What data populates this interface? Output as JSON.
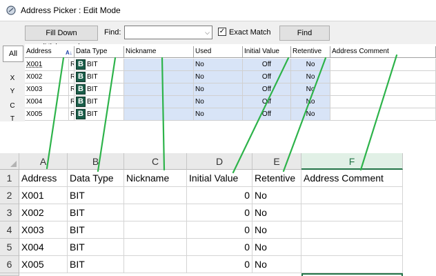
{
  "window": {
    "title": "Address Picker : Edit Mode"
  },
  "toolbar": {
    "fill_down_label": "Fill Down (Nickname)",
    "find_label": "Find:",
    "find_value": "",
    "exact_match_label": "Exact Match",
    "exact_match_checked": true,
    "find_button_label": "Find"
  },
  "side_tabs": [
    "All",
    "X",
    "Y",
    "C",
    "T"
  ],
  "picker_grid": {
    "columns": [
      "Address",
      "Data Type",
      "Nickname",
      "Used",
      "Initial Value",
      "Retentive",
      "Address Comment"
    ],
    "rows": [
      {
        "address": "X001",
        "flag": "R",
        "type": "BIT",
        "nickname": "",
        "used": "No",
        "initial": "Off",
        "retentive": "No",
        "comment": ""
      },
      {
        "address": "X002",
        "flag": "R",
        "type": "BIT",
        "nickname": "",
        "used": "No",
        "initial": "Off",
        "retentive": "No",
        "comment": ""
      },
      {
        "address": "X003",
        "flag": "R",
        "type": "BIT",
        "nickname": "",
        "used": "No",
        "initial": "Off",
        "retentive": "No",
        "comment": ""
      },
      {
        "address": "X004",
        "flag": "R",
        "type": "BIT",
        "nickname": "",
        "used": "No",
        "initial": "Off",
        "retentive": "No",
        "comment": ""
      },
      {
        "address": "X005",
        "flag": "R",
        "type": "BIT",
        "nickname": "",
        "used": "No",
        "initial": "Off",
        "retentive": "No",
        "comment": ""
      }
    ],
    "type_badge": "B"
  },
  "spreadsheet": {
    "col_letters": [
      "A",
      "B",
      "C",
      "D",
      "E",
      "F"
    ],
    "row_numbers": [
      "1",
      "2",
      "3",
      "4",
      "5",
      "6"
    ],
    "header_row": [
      "Address",
      "Data Type",
      "Nickname",
      "Initial Value",
      "Retentive",
      "Address Comment"
    ],
    "rows": [
      [
        "X001",
        "BIT",
        "",
        "0",
        "No",
        ""
      ],
      [
        "X002",
        "BIT",
        "",
        "0",
        "No",
        ""
      ],
      [
        "X003",
        "BIT",
        "",
        "0",
        "No",
        ""
      ],
      [
        "X004",
        "BIT",
        "",
        "0",
        "No",
        ""
      ],
      [
        "X005",
        "BIT",
        "",
        "0",
        "No",
        ""
      ]
    ],
    "selected_column": "F"
  },
  "colors": {
    "connector": "#2db34a",
    "used_bg": "#d8e4f7",
    "excel_green": "#217346"
  }
}
